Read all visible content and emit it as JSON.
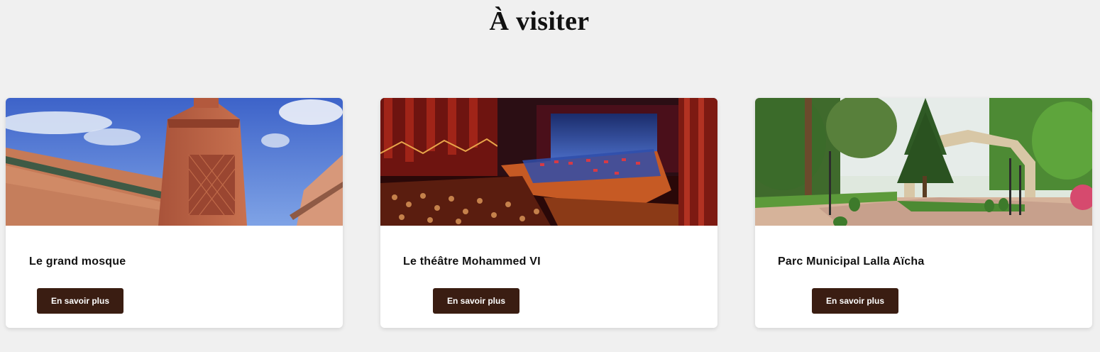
{
  "section": {
    "title": "À visiter"
  },
  "cards": [
    {
      "title": "Le grand mosque",
      "button_label": "En savoir plus",
      "image_subject": "mosque-minaret"
    },
    {
      "title": "Le théâtre Mohammed VI",
      "button_label": "En savoir plus",
      "image_subject": "theatre-stage"
    },
    {
      "title": "Parc Municipal Lalla Aïcha",
      "button_label": "En savoir plus",
      "image_subject": "park-arch"
    }
  ],
  "colors": {
    "page_background": "#f0f0f0",
    "card_background": "#ffffff",
    "button_background": "#3a1d12",
    "button_text": "#ffffff"
  }
}
